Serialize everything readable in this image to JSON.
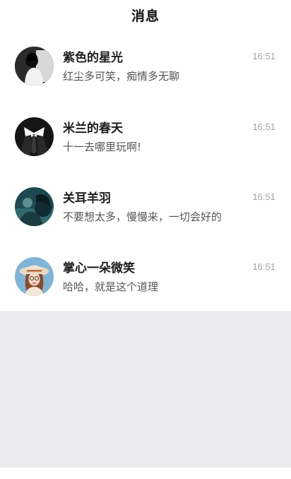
{
  "header": {
    "title": "消息"
  },
  "messages": [
    {
      "name": "紫色的星光",
      "preview": "红尘多可笑，痴情多无聊",
      "time": "16:51",
      "avatar_icon": "person-portrait-avatar"
    },
    {
      "name": "米兰的春天",
      "preview": "十一去哪里玩啊!",
      "time": "16:51",
      "avatar_icon": "suit-collar-avatar"
    },
    {
      "name": "关耳羊羽",
      "preview": "不要想太多，慢慢来，一切会好的",
      "time": "16:51",
      "avatar_icon": "teal-portrait-avatar"
    },
    {
      "name": "掌心一朵微笑",
      "preview": "哈哈，就是这个道理",
      "time": "16:51",
      "avatar_icon": "girl-with-hat-avatar"
    }
  ],
  "colors": {
    "background": "#ffffff",
    "empty_area": "#ececee",
    "name_text": "#1e1e1e",
    "preview_text": "#555555",
    "time_text": "#a3a3a3"
  }
}
